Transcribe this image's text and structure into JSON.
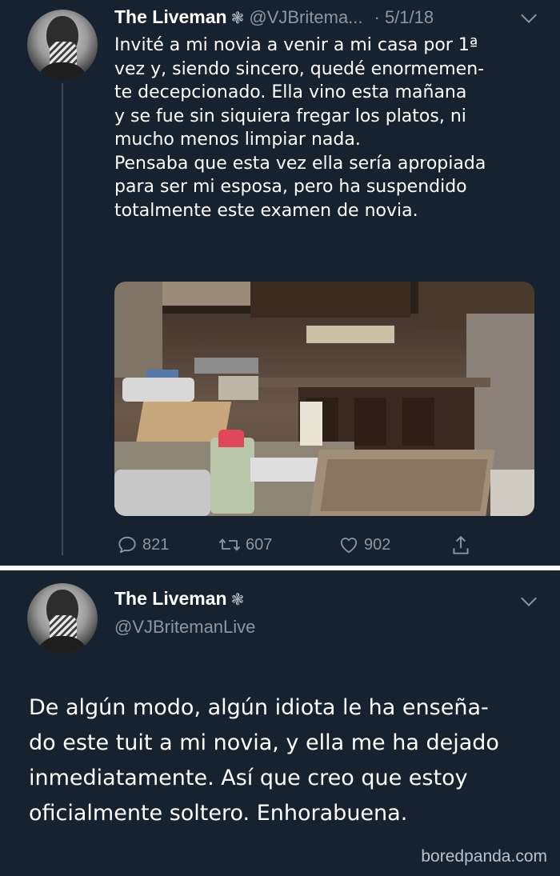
{
  "tweet1": {
    "display_name": "The Liveman",
    "badge_icon": "flower-icon",
    "handle": "@VJBritema...",
    "date": "· 5/1/18",
    "body": "Invité a mi novia a venir a mi casa por 1ª\nvez y, siendo sincero, quedé enormemen-\nte decepcionado. Ella vino esta mañana\ny se fue sin siquiera fregar los platos, ni\nmucho menos limpiar nada.\nPensaba que esta vez ella sería apropiada\npara ser mi esposa, pero ha suspendido\ntotalmente este examen de novia.",
    "actions": {
      "replies": "821",
      "retweets": "607",
      "likes": "902"
    }
  },
  "tweet2": {
    "display_name": "The Liveman",
    "badge_icon": "flower-icon",
    "handle": "@VJBritemanLive",
    "body": "De algún modo, algún idiota le ha enseña-\ndo este tuit a mi novia, y ella me ha dejado\ninmediatamente. Así que creo que estoy\noficialmente soltero. Enhorabuena."
  },
  "watermark": "boredpanda.com",
  "colors": {
    "background": "#172230",
    "text": "#ffffff",
    "muted": "#8899a6",
    "separator": "#ffffff"
  }
}
